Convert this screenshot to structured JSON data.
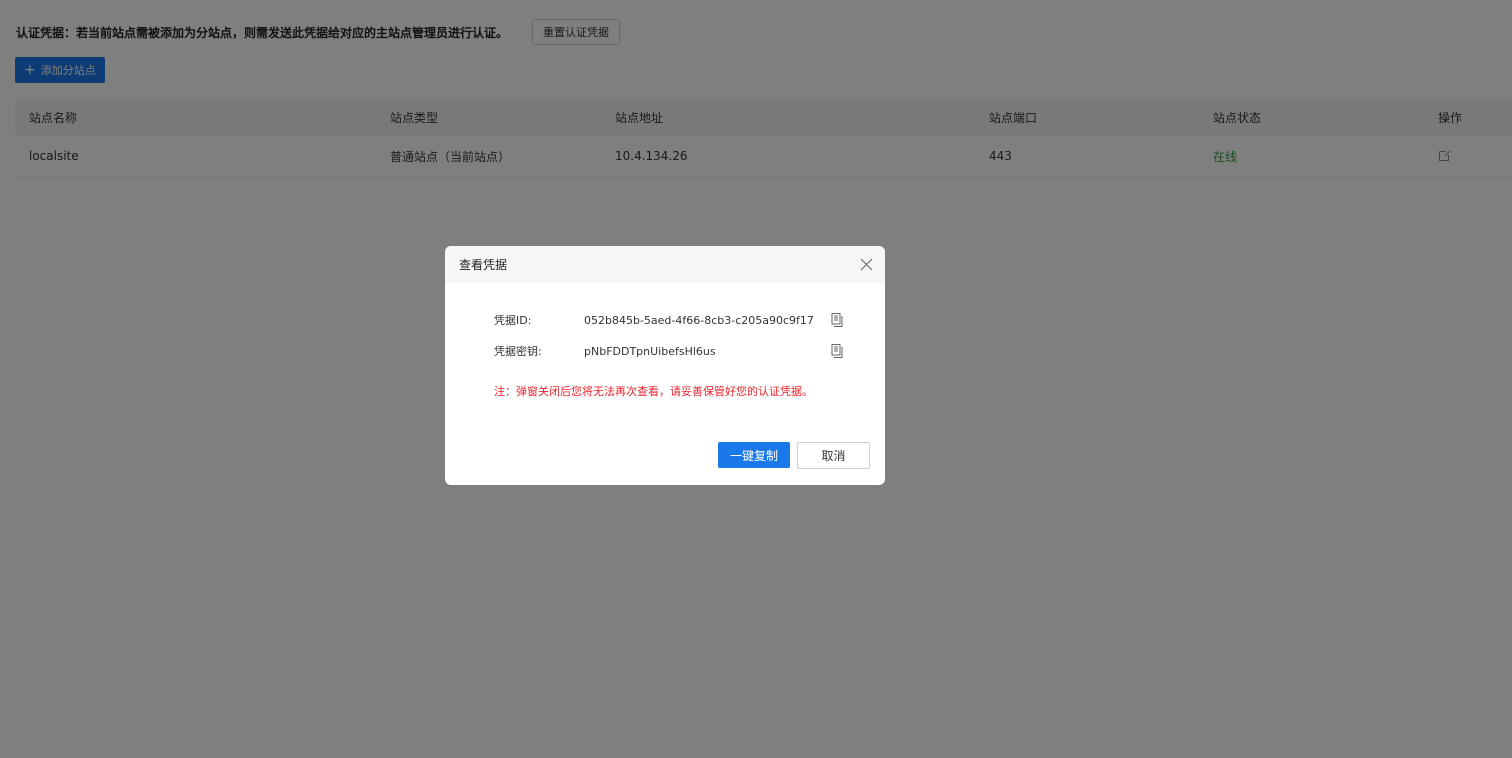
{
  "credential_bar": {
    "text": "认证凭据：若当前站点需被添加为分站点，则需发送此凭据给对应的主站点管理员进行认证。",
    "reset_label": "重置认证凭据"
  },
  "add_button": {
    "icon": "plus-icon",
    "label": "添加分站点"
  },
  "table": {
    "columns": [
      "站点名称",
      "站点类型",
      "站点地址",
      "站点端口",
      "站点状态",
      "操作"
    ],
    "rows": [
      {
        "name": "localsite",
        "type": "普通站点（当前站点）",
        "address": "10.4.134.26",
        "port": "443",
        "status": "在线",
        "action_icon": "edit-icon"
      }
    ]
  },
  "modal": {
    "title": "查看凭据",
    "credential_id_label": "凭据ID:",
    "credential_id_value": "052b845b-5aed-4f66-8cb3-c205a90c9f17",
    "credential_key_label": "凭据密钥:",
    "credential_key_value": "pNbFDDTpnUibefsHl6us",
    "warning": "注：弹窗关闭后您将无法再次查看，请妥善保管好您的认证凭据。",
    "copy_all_label": "一键复制",
    "cancel_label": "取消",
    "close_icon": "close-icon",
    "copy_icon": "copy-icon"
  },
  "colors": {
    "primary": "#1b78e8",
    "online": "#2e9b3a",
    "warning": "#e8252e",
    "overlay": "rgba(0,0,0,0.5)"
  }
}
